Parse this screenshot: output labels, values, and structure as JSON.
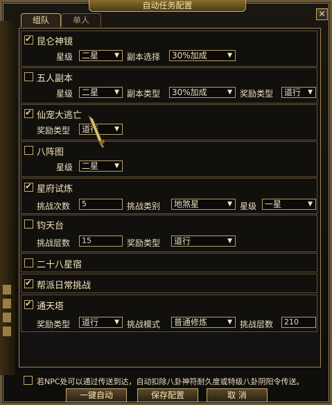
{
  "window": {
    "title": "自动任务配置",
    "close_label": "✕"
  },
  "tabs": [
    {
      "label": "组队",
      "active": true
    },
    {
      "label": "单人",
      "active": false
    }
  ],
  "sections": [
    {
      "name": "昆仑神镜",
      "checked": true,
      "row": [
        {
          "label": "星级",
          "value": "二星",
          "type": "select"
        },
        {
          "label": "副本选择",
          "value": "30%加成",
          "type": "select"
        }
      ]
    },
    {
      "name": "五人副本",
      "checked": false,
      "row": [
        {
          "label": "星级",
          "value": "二星",
          "type": "select"
        },
        {
          "label": "副本类型",
          "value": "30%加成",
          "type": "select"
        },
        {
          "label": "奖励类型",
          "value": "道行",
          "type": "select"
        }
      ]
    },
    {
      "name": "仙宠大逃亡",
      "checked": true,
      "row": [
        {
          "label": "奖励类型",
          "value": "道行",
          "type": "select"
        }
      ]
    },
    {
      "name": "八阵图",
      "checked": false,
      "row": [
        {
          "label": "星级",
          "value": "二星",
          "type": "select"
        }
      ]
    },
    {
      "name": "星府试炼",
      "checked": true,
      "row": [
        {
          "label": "挑战次数",
          "value": "5",
          "type": "input"
        },
        {
          "label": "挑战类别",
          "value": "地煞星",
          "type": "select"
        },
        {
          "label": "星级",
          "value": "一星",
          "type": "select"
        }
      ]
    },
    {
      "name": "钧天台",
      "checked": false,
      "row": [
        {
          "label": "挑战层数",
          "value": "15",
          "type": "input"
        },
        {
          "label": "奖励类型",
          "value": "道行",
          "type": "select"
        }
      ]
    },
    {
      "name": "二十八星宿",
      "checked": false,
      "row": []
    },
    {
      "name": "帮派日常挑战",
      "checked": true,
      "row": []
    },
    {
      "name": "通天塔",
      "checked": true,
      "row": [
        {
          "label": "奖励类型",
          "value": "道行",
          "type": "select"
        },
        {
          "label": "挑战模式",
          "value": "普通修炼",
          "type": "select"
        },
        {
          "label": "挑战层数",
          "value": "210",
          "type": "input"
        }
      ]
    }
  ],
  "footer": {
    "note_checked": false,
    "note": "若NPC处可以通过传送到达，自动扣除八卦神符耐久度或特级八卦阴阳令传送。",
    "buttons": {
      "auto": "一键自动",
      "save": "保存配置",
      "cancel": "取 消"
    }
  },
  "icons": {
    "check": "check-icon",
    "dropdown": "triangle-down-icon",
    "close": "close-icon"
  },
  "colors": {
    "gold": "#c9a86a",
    "text": "#e8dcc0",
    "background": "#12100d"
  }
}
